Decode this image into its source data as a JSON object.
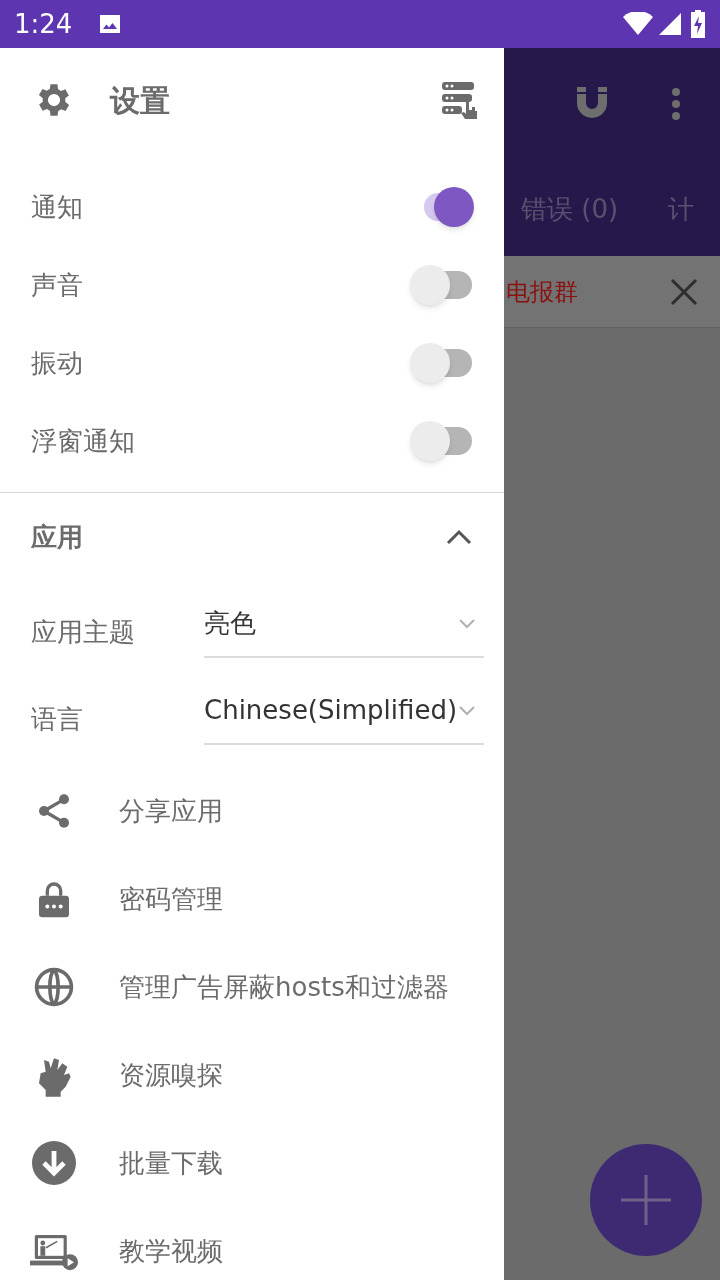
{
  "status_bar": {
    "time": "1:24"
  },
  "background_app": {
    "tabs": [
      {
        "label": "错误 (0)"
      },
      {
        "label": "计"
      }
    ],
    "banner": {
      "text": "电报群"
    }
  },
  "drawer": {
    "title": "设置",
    "switches": [
      {
        "label": "通知",
        "on": true
      },
      {
        "label": "声音",
        "on": false
      },
      {
        "label": "振动",
        "on": false
      },
      {
        "label": "浮窗通知",
        "on": false
      }
    ],
    "section": {
      "title": "应用",
      "expanded": true
    },
    "dropdowns": [
      {
        "label": "应用主题",
        "value": "亮色"
      },
      {
        "label": "语言",
        "value": "Chinese(Simplified)"
      }
    ],
    "items": [
      {
        "kind": "share",
        "label": "分享应用"
      },
      {
        "kind": "lock",
        "label": "密码管理"
      },
      {
        "kind": "globe",
        "label": "管理广告屏蔽hosts和过滤器"
      },
      {
        "kind": "fist",
        "label": "资源嗅探"
      },
      {
        "kind": "download",
        "label": "批量下载"
      },
      {
        "kind": "video",
        "label": "教学视频"
      }
    ]
  }
}
